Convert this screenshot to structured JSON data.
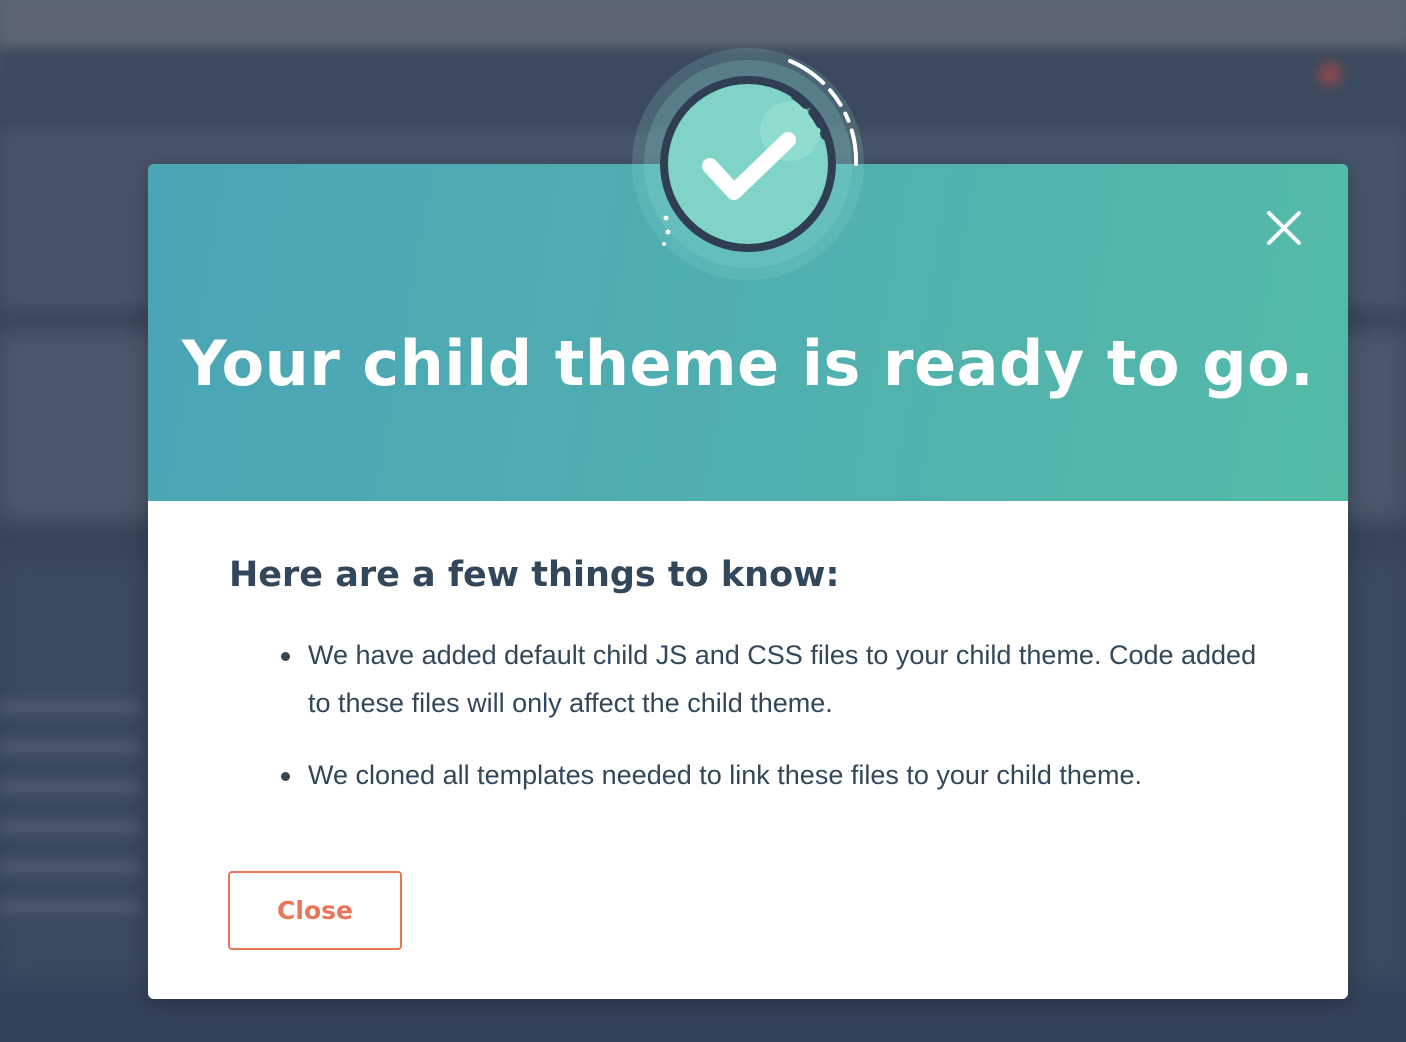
{
  "modal": {
    "title": "Your child theme is ready to go.",
    "heading": "Here are a few things to know:",
    "notes": [
      "We have added default child JS and CSS files to your child theme. Code added to these files will only affect the child theme.",
      "We cloned all templates needed to link these files to your child theme."
    ],
    "close_button_label": "Close",
    "icons": {
      "success_badge": "checkmark-badge-icon",
      "dismiss": "close-icon"
    }
  },
  "colors": {
    "header_gradient_start": "#4aa5b6",
    "header_gradient_end": "#54bba7",
    "text_primary": "#33475b",
    "button_accent": "#e8765a",
    "badge_fill": "#7fd3c7",
    "badge_ring": "#2f3e52"
  }
}
